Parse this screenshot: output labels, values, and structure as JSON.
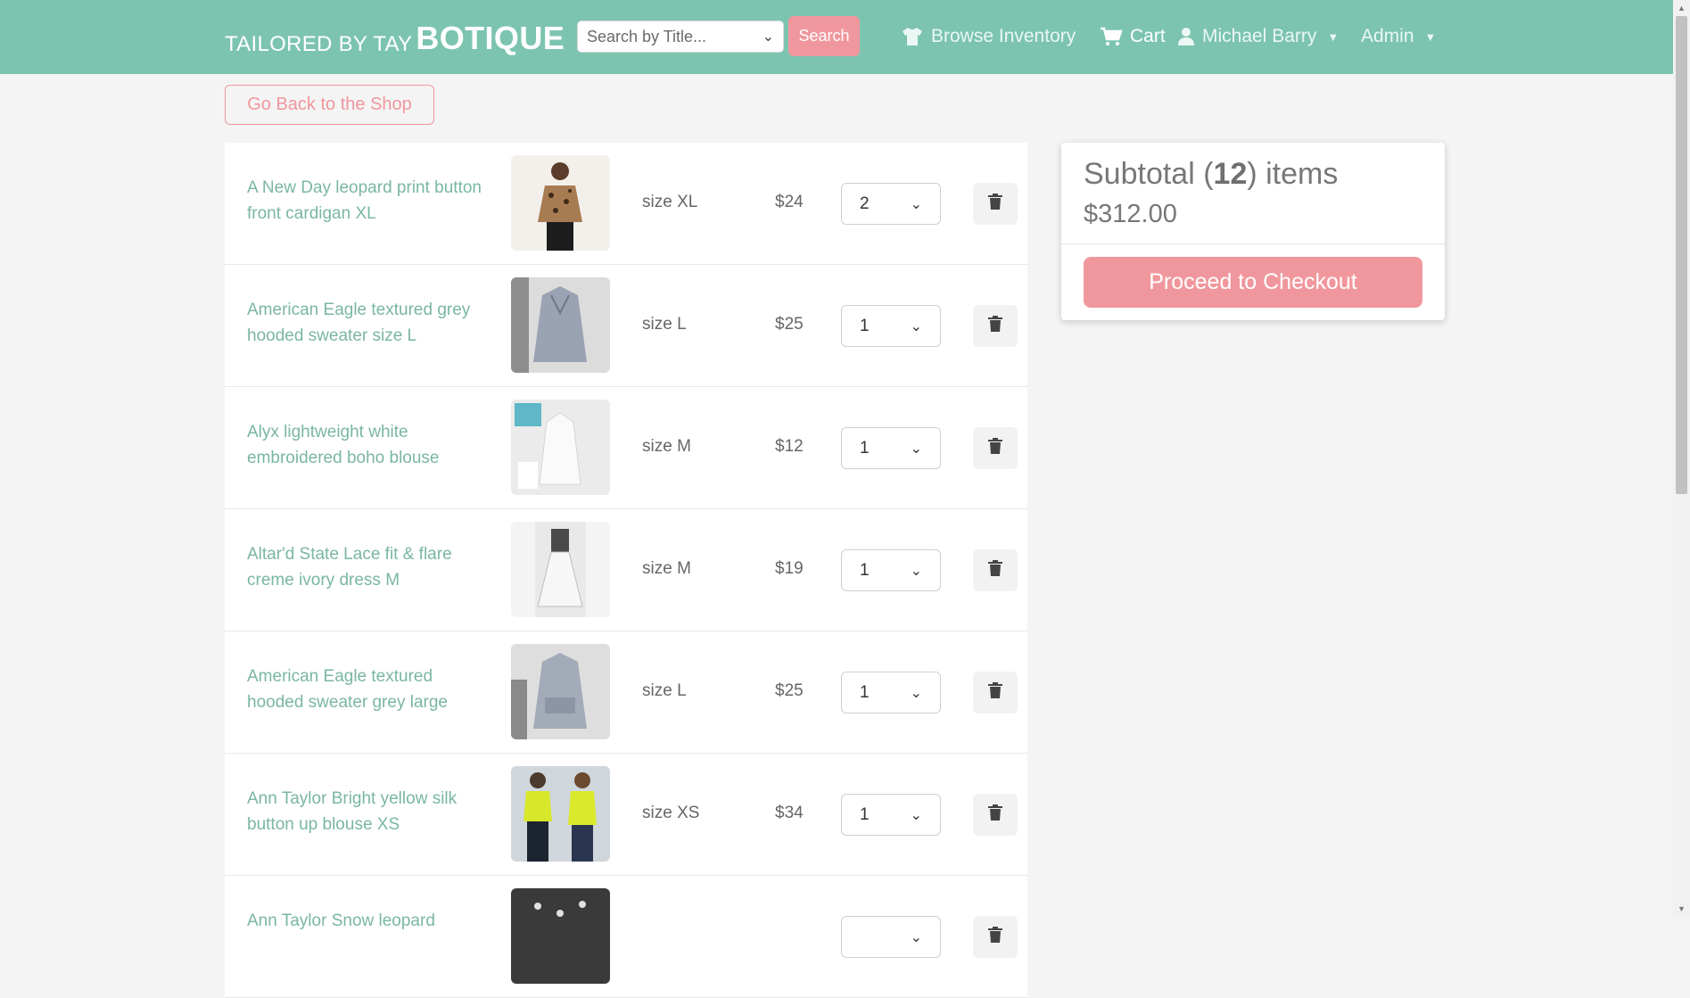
{
  "brand": {
    "prefix": "TAILORED BY TAY",
    "name": "BOTIQUE"
  },
  "search": {
    "placeholder": "Search by Title...",
    "button": "Search"
  },
  "nav": {
    "browse": "Browse Inventory",
    "cart": "Cart",
    "user": "Michael Barry",
    "admin": "Admin"
  },
  "back_button": "Go Back to the Shop",
  "cart": {
    "items": [
      {
        "title": "A New Day leopard print button front cardigan XL",
        "size": "size XL",
        "price": "$24",
        "qty": "2"
      },
      {
        "title": "American Eagle textured grey hooded sweater size L",
        "size": "size L",
        "price": "$25",
        "qty": "1"
      },
      {
        "title": "Alyx lightweight white embroidered boho blouse",
        "size": "size M",
        "price": "$12",
        "qty": "1"
      },
      {
        "title": "Altar'd State Lace fit & flare creme ivory dress M",
        "size": "size M",
        "price": "$19",
        "qty": "1"
      },
      {
        "title": "American Eagle textured hooded sweater grey large",
        "size": "size L",
        "price": "$25",
        "qty": "1"
      },
      {
        "title": "Ann Taylor Bright yellow silk button up blouse XS",
        "size": "size XS",
        "price": "$34",
        "qty": "1"
      },
      {
        "title": "Ann Taylor Snow leopard",
        "size": "",
        "price": "",
        "qty": ""
      }
    ]
  },
  "summary": {
    "label_pre": "Subtotal (",
    "count": "12",
    "label_post": ") items",
    "amount": "$312.00",
    "checkout": "Proceed to Checkout"
  },
  "colors": {
    "teal": "#7cc4b0",
    "pink": "#f0979d"
  }
}
